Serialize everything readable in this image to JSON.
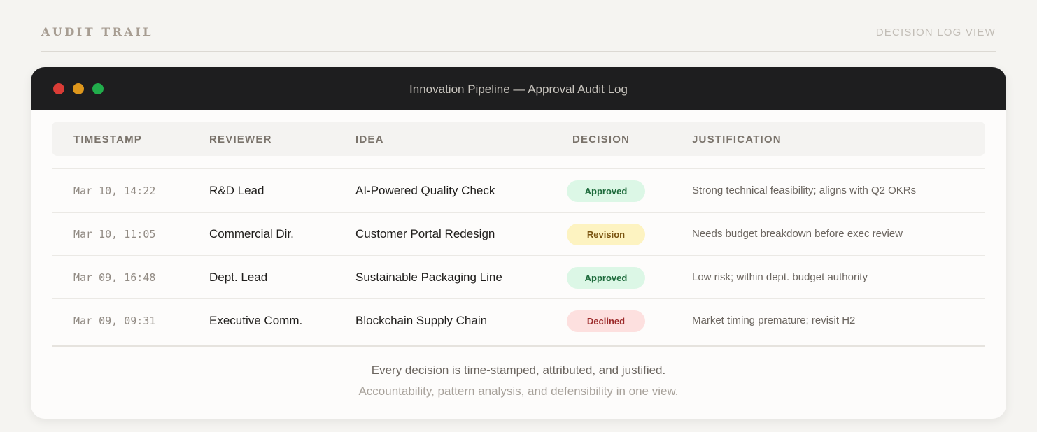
{
  "header": {
    "section_label": "AUDIT TRAIL",
    "view_label": "DECISION LOG VIEW"
  },
  "window": {
    "title": "Innovation Pipeline — Approval Audit Log"
  },
  "table": {
    "columns": [
      "TIMESTAMP",
      "REVIEWER",
      "IDEA",
      "DECISION",
      "JUSTIFICATION"
    ],
    "rows": [
      {
        "timestamp": "Mar 10, 14:22",
        "reviewer": "R&D Lead",
        "idea": "AI-Powered Quality Check",
        "decision": "Approved",
        "justification": "Strong technical feasibility; aligns with Q2 OKRs"
      },
      {
        "timestamp": "Mar 10, 11:05",
        "reviewer": "Commercial Dir.",
        "idea": "Customer Portal Redesign",
        "decision": "Revision",
        "justification": "Needs budget breakdown before exec review"
      },
      {
        "timestamp": "Mar 09, 16:48",
        "reviewer": "Dept. Lead",
        "idea": "Sustainable Packaging Line",
        "decision": "Approved",
        "justification": "Low risk; within dept. budget authority"
      },
      {
        "timestamp": "Mar 09, 09:31",
        "reviewer": "Executive Comm.",
        "idea": "Blockchain Supply Chain",
        "decision": "Declined",
        "justification": "Market timing premature; revisit H2"
      }
    ]
  },
  "decision_styles": {
    "Approved": {
      "bg": "#dcf7e6",
      "fg": "#1e6b3c"
    },
    "Revision": {
      "bg": "#fdf3c1",
      "fg": "#7a5410"
    },
    "Declined": {
      "bg": "#fde0df",
      "fg": "#9c2b2b"
    }
  },
  "footer": {
    "line1": "Every decision is time-stamped, attributed, and justified.",
    "line2": "Accountability, pattern analysis, and defensibility in one view."
  },
  "colors": {
    "titlebar": "#1e1e1f",
    "traffic_red": "#da3c36",
    "traffic_yellow": "#de971c",
    "traffic_green": "#21ad4b"
  }
}
